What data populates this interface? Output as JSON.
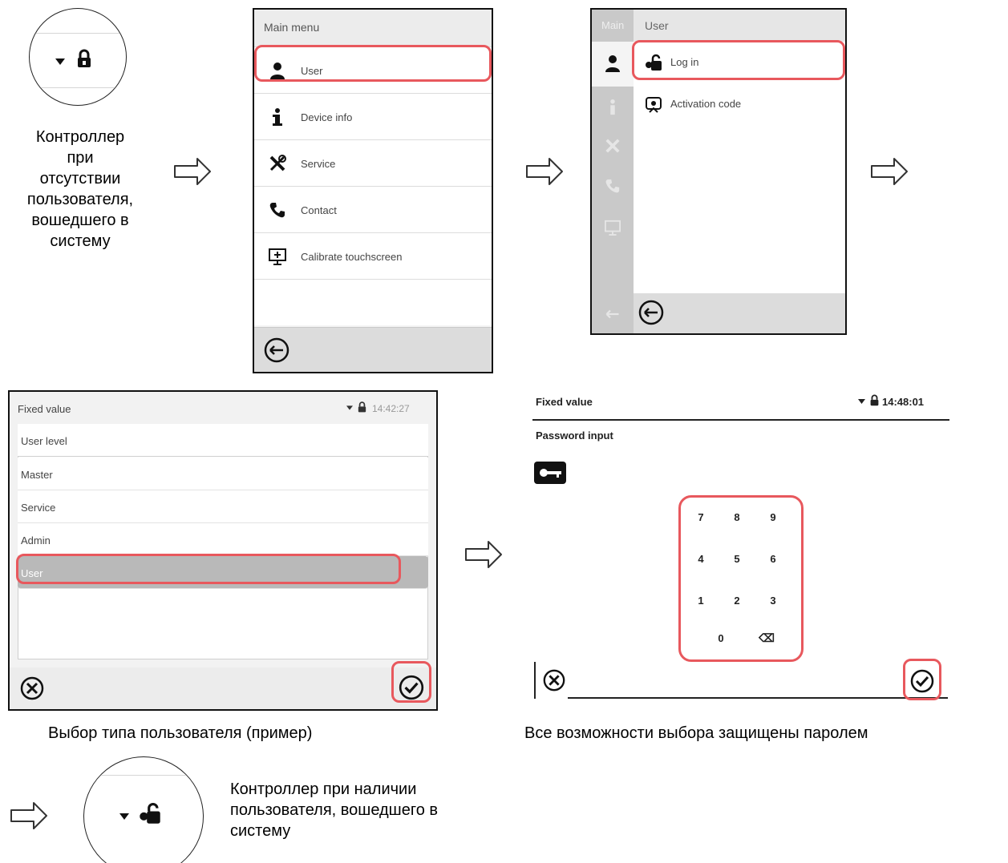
{
  "captions": {
    "logged_out": "Контроллер\nпри\nотсутствии\nпользователя,\nвошедшего в\nсистему",
    "user_select": "Выбор типа пользователя (пример)",
    "password": "Все возможности выбора защищены паролем",
    "logged_in": "Контроллер при наличии\nпользователя, вошедшего в\nсистему"
  },
  "main_menu": {
    "title": "Main menu",
    "items": [
      {
        "label": "User",
        "icon": "user-icon"
      },
      {
        "label": "Device info",
        "icon": "info-icon"
      },
      {
        "label": "Service",
        "icon": "service-icon"
      },
      {
        "label": "Contact",
        "icon": "phone-icon"
      },
      {
        "label": "Calibrate touchscreen",
        "icon": "touchscreen-icon"
      }
    ]
  },
  "user_menu": {
    "side_title": "Main",
    "title": "User",
    "items": [
      {
        "label": "Log in",
        "icon": "login-lock-icon"
      },
      {
        "label": "Activation code",
        "icon": "activation-code-icon"
      }
    ]
  },
  "user_level": {
    "screen_title": "Fixed value",
    "time": "14:42:27",
    "header": "User level",
    "options": [
      "Master",
      "Service",
      "Admin",
      "User"
    ],
    "selected": "User"
  },
  "password_screen": {
    "screen_title": "Fixed value",
    "time": "14:48:01",
    "prompt": "Password input",
    "keypad": [
      "7",
      "8",
      "9",
      "4",
      "5",
      "6",
      "1",
      "2",
      "3",
      "0",
      "⌫"
    ]
  },
  "colors": {
    "highlight": "#e8585d",
    "panel": "#f4f4f4",
    "footer": "#dcdcdc"
  }
}
